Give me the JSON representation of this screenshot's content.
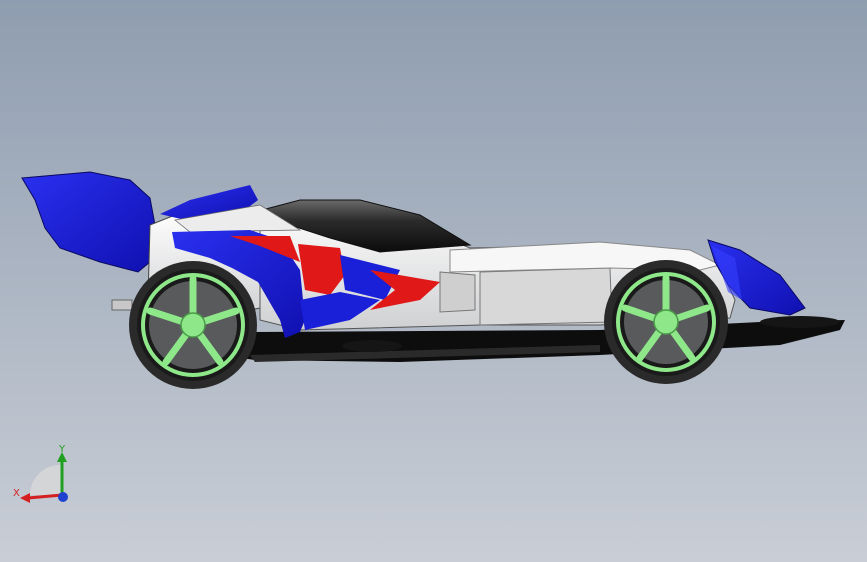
{
  "triad": {
    "x_label": "X",
    "y_label": "Y",
    "x_color": "#d42020",
    "y_color": "#20a020",
    "z_color": "#2040d0"
  },
  "colors": {
    "bg_top": "#8f9db0",
    "bg_bottom": "#c9ced6",
    "body_blue": "#1a1fd8",
    "body_red": "#e01818",
    "body_white": "#f2f2f2",
    "wheel_green": "#8ee88a",
    "tire": "#2a2a2a",
    "chassis": "#111111"
  },
  "icons": {
    "triad": "coordinate-triad-icon"
  }
}
